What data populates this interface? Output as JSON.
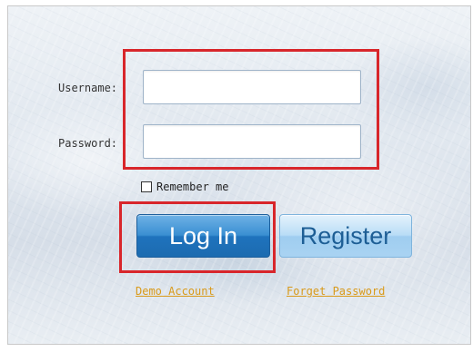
{
  "form": {
    "username_label": "Username:",
    "password_label": "Password:",
    "username_value": "",
    "password_value": "",
    "remember_label": "Remember me",
    "remember_checked": false
  },
  "buttons": {
    "login_label": "Log In",
    "register_label": "Register"
  },
  "links": {
    "demo_account": "Demo Account",
    "forget_password": "Forget Password"
  },
  "colors": {
    "highlight": "#d8262b",
    "login_blue": "#1f73bd",
    "link_orange": "#d99a1a"
  }
}
